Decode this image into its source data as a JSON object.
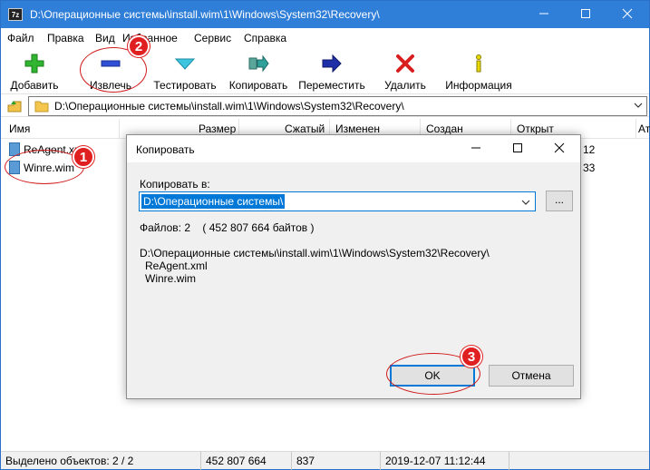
{
  "window": {
    "app_icon_text": "7z",
    "title": "D:\\Операционные системы\\install.wim\\1\\Windows\\System32\\Recovery\\"
  },
  "menu": [
    "Файл",
    "Правка",
    "Вид",
    "Избранное",
    "Сервис",
    "Справка"
  ],
  "toolbar": {
    "add": "Добавить",
    "extract": "Извлечь",
    "test": "Тестировать",
    "copy": "Копировать",
    "move": "Переместить",
    "delete": "Удалить",
    "info": "Информация"
  },
  "address": {
    "path": "D:\\Операционные системы\\install.wim\\1\\Windows\\System32\\Recovery\\"
  },
  "columns": {
    "name": "Имя",
    "size": "Размер",
    "packed": "Сжатый",
    "modified": "Изменен",
    "created": "Создан",
    "opened": "Открыт",
    "attr": "Ат"
  },
  "files": [
    {
      "name": "ReAgent.xml",
      "cut": "12"
    },
    {
      "name": "Winre.wim",
      "cut": "33"
    }
  ],
  "dialog": {
    "title": "Копировать",
    "copy_to_label": "Копировать в:",
    "destination": "D:\\Операционные системы\\",
    "browse_label": "...",
    "files_info": "Файлов: 2    ( 452 807 664 байтов )",
    "source_path": "D:\\Операционные системы\\install.wim\\1\\Windows\\System32\\Recovery\\",
    "file_list": [
      "ReAgent.xml",
      "Winre.wim"
    ],
    "ok_label": "OK",
    "cancel_label": "Отмена"
  },
  "status": {
    "selected": "Выделено объектов: 2 / 2",
    "size": "452 807 664",
    "packed": "837",
    "date": "2019-12-07 11:12:44"
  },
  "annotations": {
    "badge1": "1",
    "badge2": "2",
    "badge3": "3"
  },
  "colors": {
    "titlebar": "#2f7ed8",
    "accent": "#0078d7",
    "annotation_red": "#e02020"
  }
}
